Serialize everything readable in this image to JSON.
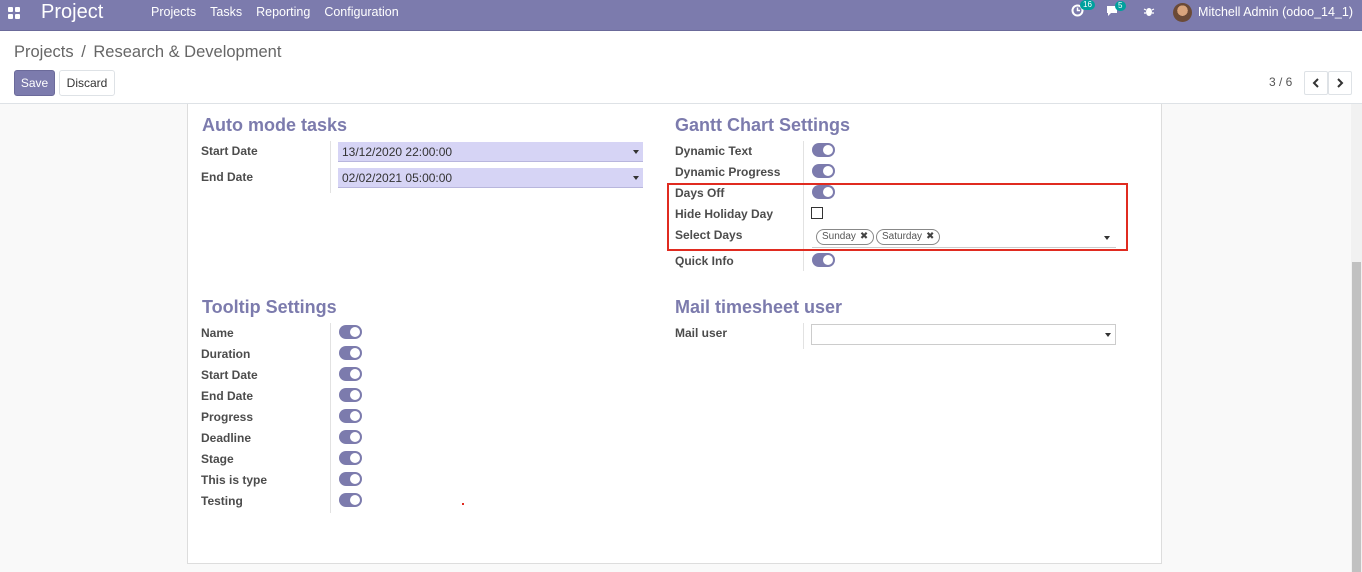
{
  "navbar": {
    "brand": "Project",
    "menu": [
      "Projects",
      "Tasks",
      "Reporting",
      "Configuration"
    ],
    "activity_count": "16",
    "message_count": "5",
    "user": "Mitchell Admin (odoo_14_1)"
  },
  "control_panel": {
    "breadcrumb_parent": "Projects",
    "breadcrumb_sep": "/",
    "breadcrumb_current": "Research & Development",
    "save_label": "Save",
    "discard_label": "Discard",
    "pager": "3 / 6"
  },
  "auto_mode": {
    "title": "Auto mode tasks",
    "start_label": "Start Date",
    "start_value": "13/12/2020 22:00:00",
    "end_label": "End Date",
    "end_value": "02/02/2021 05:00:00"
  },
  "gantt": {
    "title": "Gantt Chart Settings",
    "dynamic_text": "Dynamic Text",
    "dynamic_progress": "Dynamic Progress",
    "days_off": "Days Off",
    "hide_holiday": "Hide Holiday Day",
    "select_days": "Select Days",
    "tags": [
      "Sunday",
      "Saturday"
    ],
    "quick_info": "Quick Info"
  },
  "tooltip": {
    "title": "Tooltip Settings",
    "items": [
      "Name",
      "Duration",
      "Start Date",
      "End Date",
      "Progress",
      "Deadline",
      "Stage",
      "This is type",
      "Testing"
    ]
  },
  "mail": {
    "title": "Mail timesheet user",
    "label": "Mail user"
  },
  "colors": {
    "brand": "#7c7bad",
    "highlight": "#e02b20",
    "badge": "#00a09d"
  }
}
